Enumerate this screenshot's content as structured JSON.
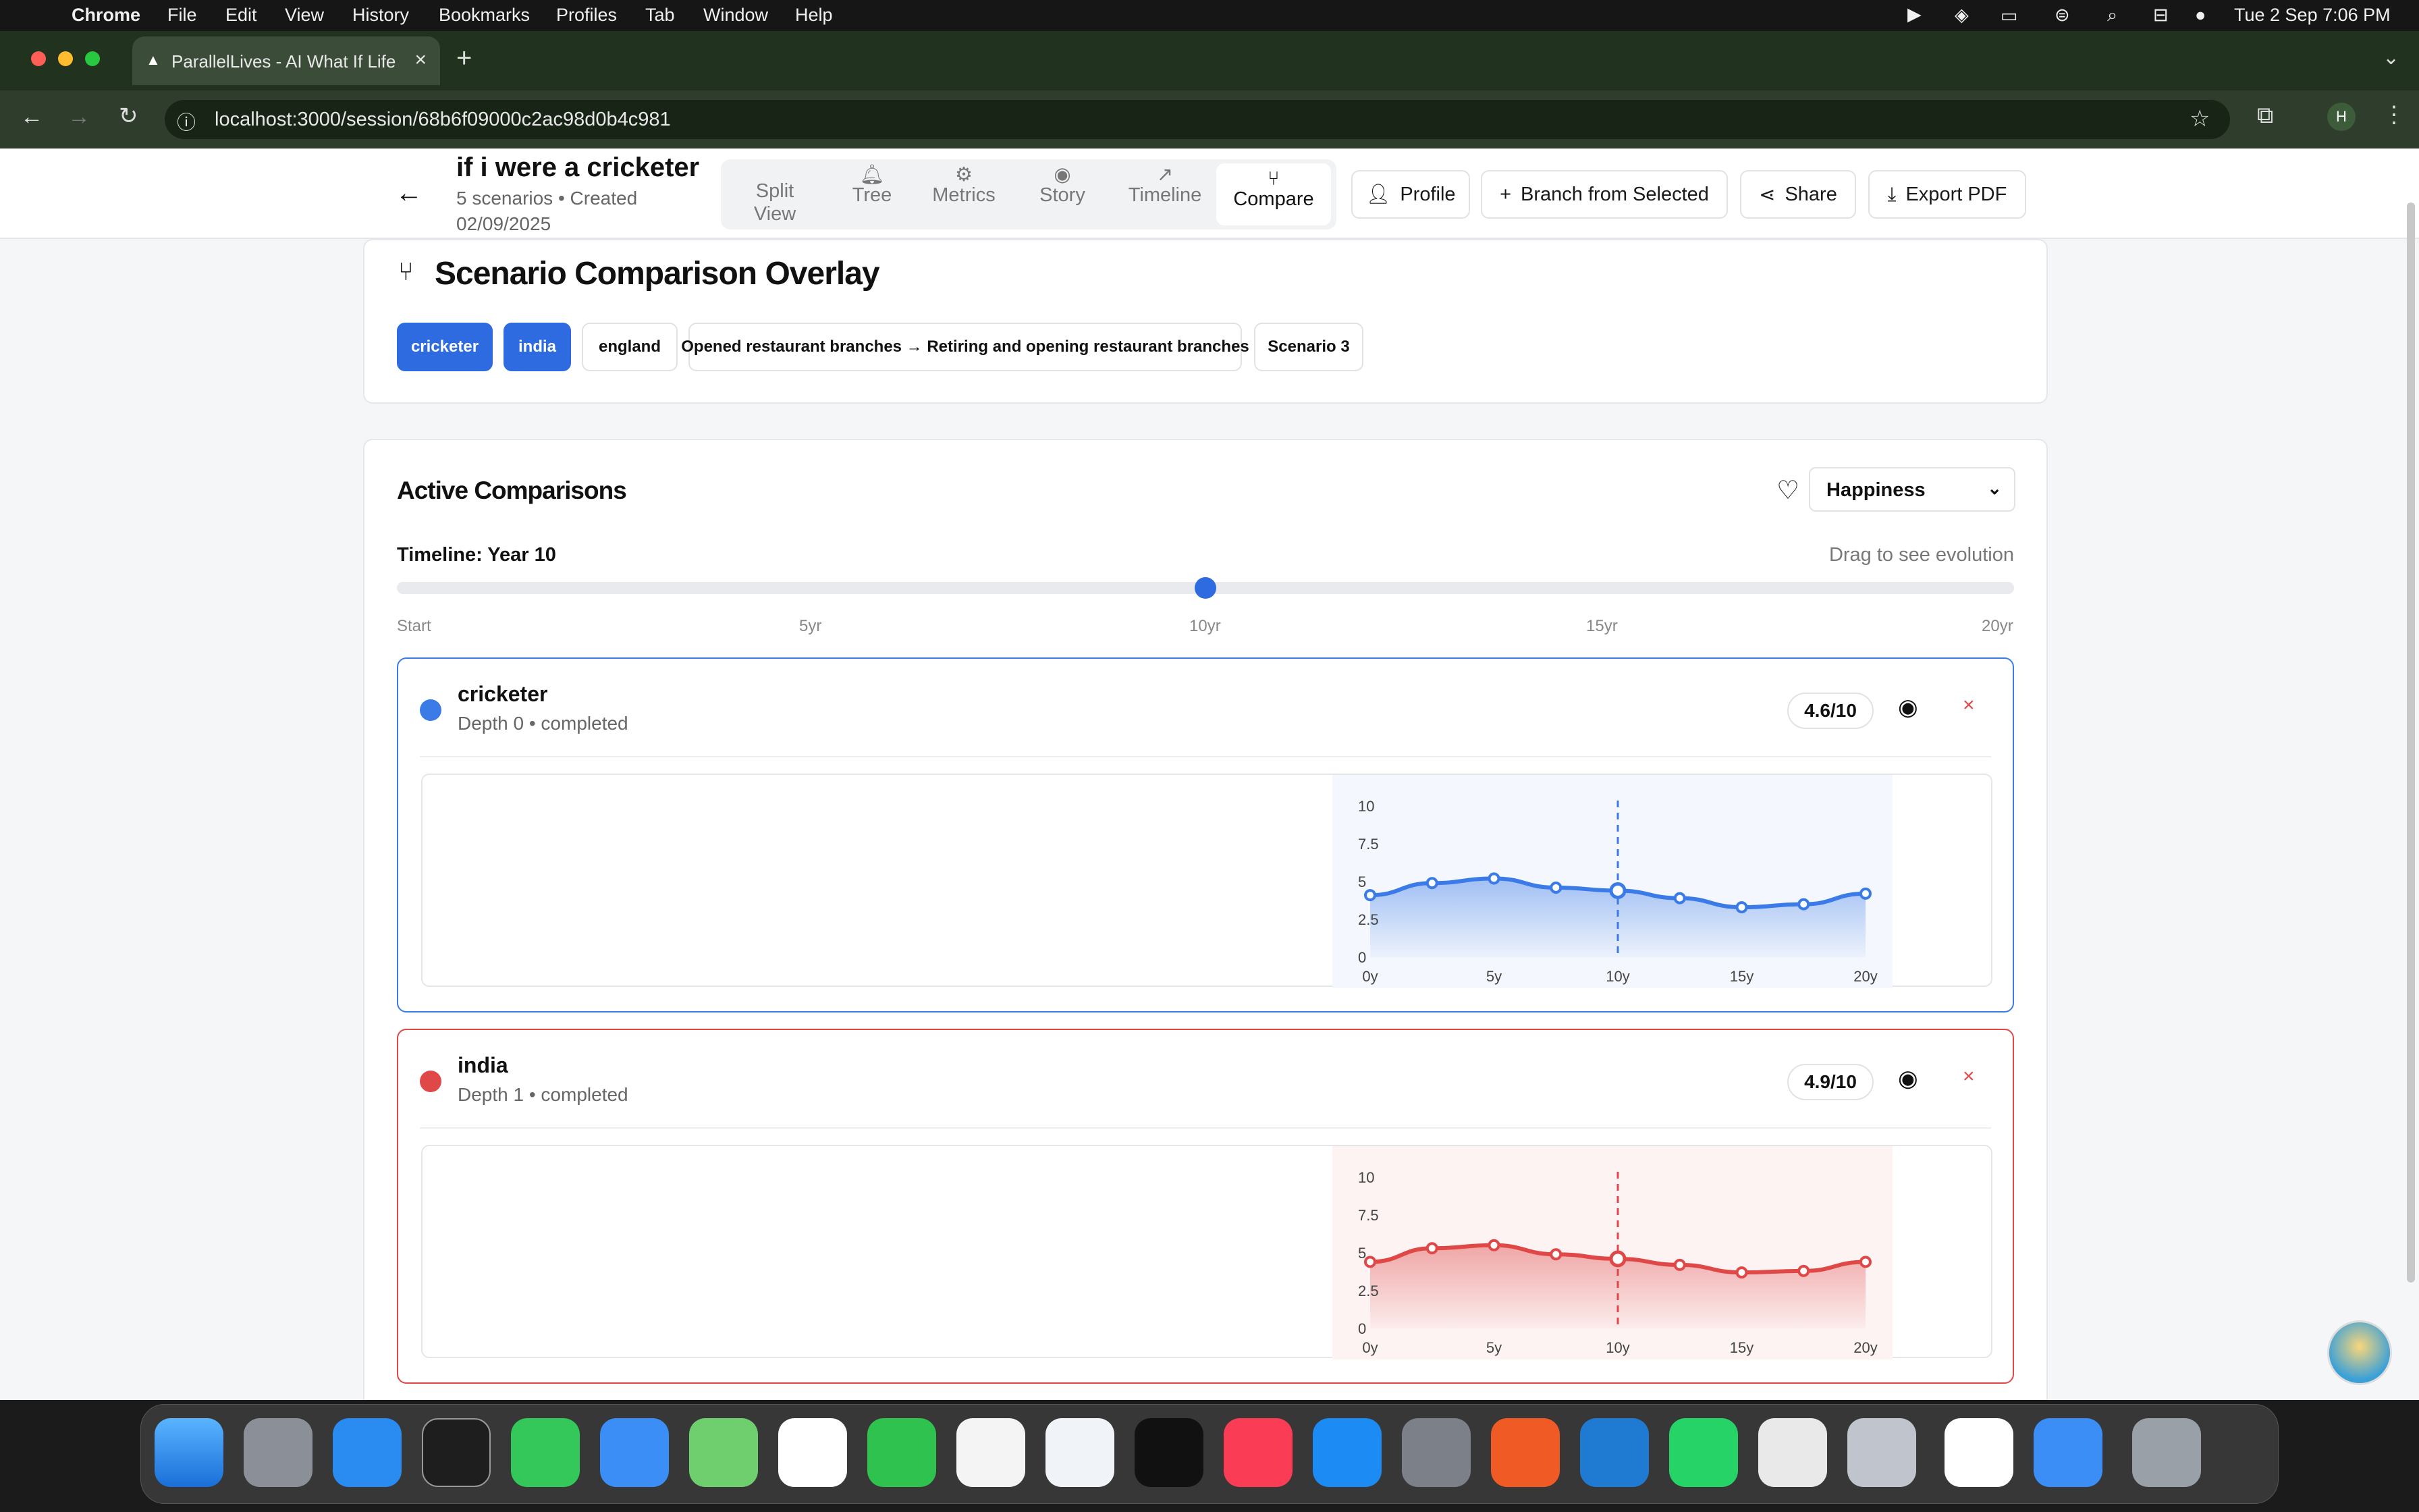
{
  "menubar": {
    "app": "Chrome",
    "items": [
      "File",
      "Edit",
      "View",
      "History",
      "Bookmarks",
      "Profiles",
      "Tab",
      "Window",
      "Help"
    ],
    "clock": "Tue 2 Sep  7:06 PM"
  },
  "browser": {
    "tab_title": "ParallelLives - AI What If Life",
    "url": "localhost:3000/session/68b6f09000c2ac98d0b4c981",
    "profile_initial": "H"
  },
  "header": {
    "title": "if i were a cricketer",
    "meta_line1": "5 scenarios • Created",
    "meta_line2": "02/09/2025",
    "tabs": [
      {
        "label": "Split\nView",
        "icon": "split-icon"
      },
      {
        "label": "Tree",
        "icon": "bell-icon"
      },
      {
        "label": "Metrics",
        "icon": "gear-icon"
      },
      {
        "label": "Story",
        "icon": "eye-icon"
      },
      {
        "label": "Timeline",
        "icon": "trend-icon"
      },
      {
        "label": "Compare",
        "icon": "branch-icon"
      }
    ],
    "profile": "Profile",
    "branch": "Branch from Selected",
    "share": "Share",
    "export": "Export PDF"
  },
  "overlay": {
    "title": "Scenario Comparison Overlay",
    "chips": [
      {
        "label": "cricketer",
        "selected": true
      },
      {
        "label": "india",
        "selected": true
      },
      {
        "label": "england",
        "selected": false
      },
      {
        "label": "Opened restaurant branches → Retiring and opening restaurant branches",
        "selected": false
      },
      {
        "label": "Scenario 3",
        "selected": false
      }
    ]
  },
  "active": {
    "title": "Active Comparisons",
    "metric": "Happiness",
    "timeline_label": "Timeline: Year 10",
    "hint": "Drag to see evolution",
    "timeline_value": 10,
    "timeline_max": 20,
    "ticks": [
      "Start",
      "5yr",
      "10yr",
      "15yr",
      "20yr"
    ]
  },
  "scenarios": [
    {
      "name": "cricketer",
      "meta": "Depth 0 • completed",
      "score": "4.6/10",
      "color": "#3b7be8"
    },
    {
      "name": "india",
      "meta": "Depth 1 • completed",
      "score": "4.9/10",
      "color": "#e04848"
    }
  ],
  "chart_data": [
    {
      "type": "area",
      "series_name": "cricketer",
      "x": [
        0,
        2.5,
        5,
        7.5,
        10,
        12.5,
        15,
        17.5,
        20
      ],
      "values": [
        4.1,
        4.9,
        5.2,
        4.6,
        4.4,
        3.9,
        3.3,
        3.5,
        4.2
      ],
      "xticks": [
        "0y",
        "5y",
        "10y",
        "15y",
        "20y"
      ],
      "yticks": [
        "10",
        "7.5",
        "5",
        "2.5",
        "0"
      ],
      "ylim": [
        0,
        10
      ],
      "marker_x": 10
    },
    {
      "type": "area",
      "series_name": "india",
      "x": [
        0,
        2.5,
        5,
        7.5,
        10,
        12.5,
        15,
        17.5,
        20
      ],
      "values": [
        4.4,
        5.3,
        5.5,
        4.9,
        4.6,
        4.2,
        3.7,
        3.8,
        4.4
      ],
      "xticks": [
        "0y",
        "5y",
        "10y",
        "15y",
        "20y"
      ],
      "yticks": [
        "10",
        "7.5",
        "5",
        "2.5",
        "0"
      ],
      "ylim": [
        0,
        10
      ],
      "marker_x": 10
    }
  ]
}
